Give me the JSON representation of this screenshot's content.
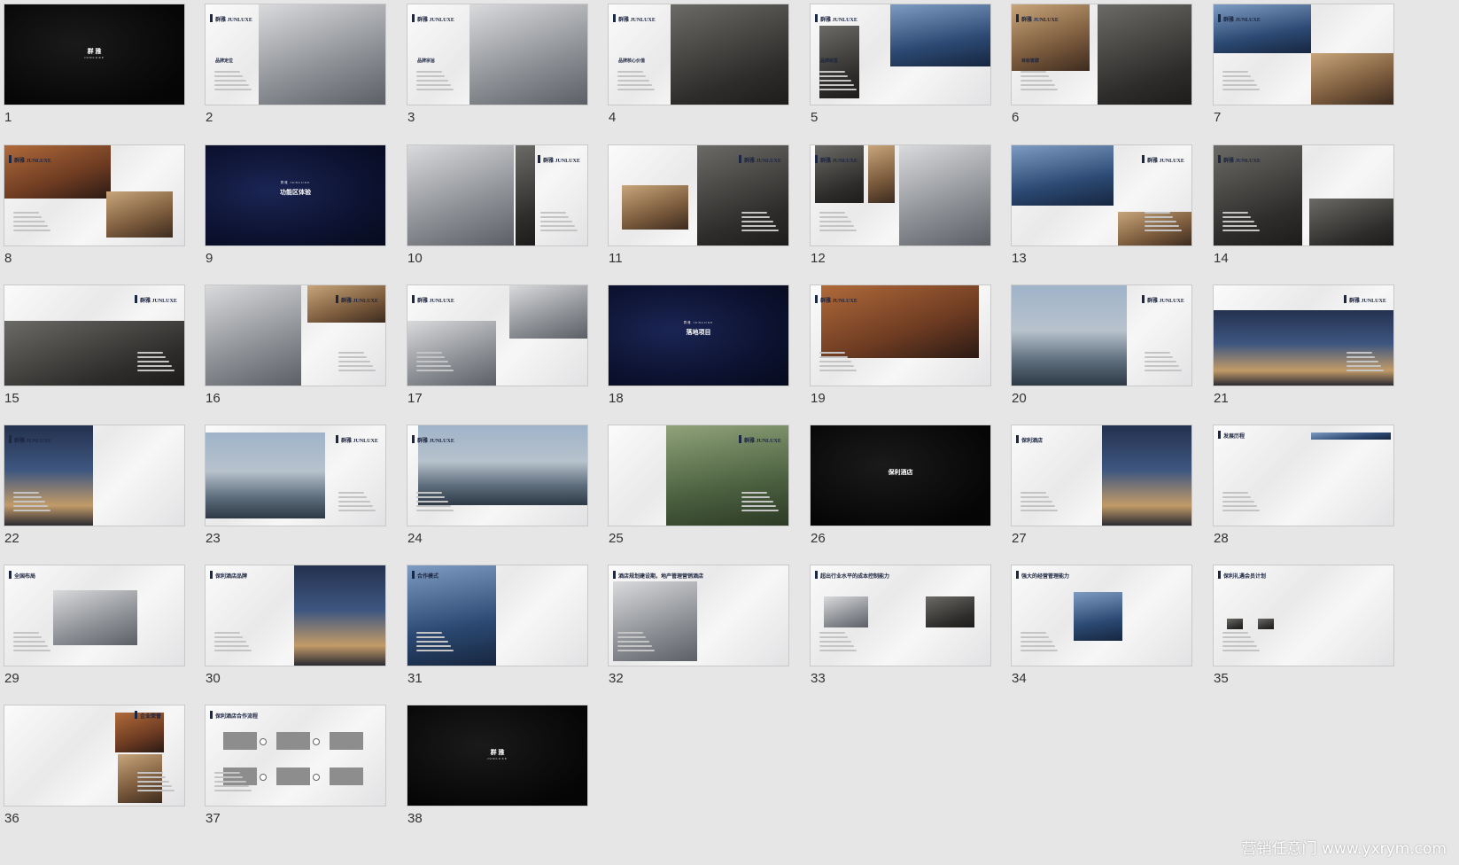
{
  "slides": [
    {
      "number": "1",
      "style": "black",
      "title": "群 雅",
      "subtitle": "JUNLUXE"
    },
    {
      "number": "2",
      "style": "white",
      "title": "群雅 JUNLUXE",
      "heading": "品牌定位"
    },
    {
      "number": "3",
      "style": "white",
      "title": "群雅 JUNLUXE",
      "heading": "品牌宗旨"
    },
    {
      "number": "4",
      "style": "white",
      "title": "群雅 JUNLUXE",
      "heading": "品牌核心价值"
    },
    {
      "number": "5",
      "style": "white",
      "title": "群雅 JUNLUXE",
      "heading": "品牌标签"
    },
    {
      "number": "6",
      "style": "white",
      "title": "群雅 JUNLUXE",
      "heading": "目标客群"
    },
    {
      "number": "7",
      "style": "white",
      "title": "群雅 JUNLUXE"
    },
    {
      "number": "8",
      "style": "white",
      "title": "群雅 JUNLUXE"
    },
    {
      "number": "9",
      "style": "navy",
      "title": "功能区体验",
      "subtitle": "群雅 JUNLUXE"
    },
    {
      "number": "10",
      "style": "white",
      "title": "群雅 JUNLUXE"
    },
    {
      "number": "11",
      "style": "white",
      "title": "群雅 JUNLUXE"
    },
    {
      "number": "12",
      "style": "white",
      "title": "群雅 JUNLUXE"
    },
    {
      "number": "13",
      "style": "white",
      "title": "群雅 JUNLUXE"
    },
    {
      "number": "14",
      "style": "white",
      "title": "群雅 JUNLUXE"
    },
    {
      "number": "15",
      "style": "white",
      "title": "群雅 JUNLUXE"
    },
    {
      "number": "16",
      "style": "white",
      "title": "群雅 JUNLUXE"
    },
    {
      "number": "17",
      "style": "white",
      "title": "群雅 JUNLUXE"
    },
    {
      "number": "18",
      "style": "navy",
      "title": "落地项目",
      "subtitle": "群雅 JUNLUXE"
    },
    {
      "number": "19",
      "style": "white",
      "title": "群雅 JUNLUXE"
    },
    {
      "number": "20",
      "style": "white",
      "title": "群雅 JUNLUXE"
    },
    {
      "number": "21",
      "style": "white",
      "title": "群雅 JUNLUXE"
    },
    {
      "number": "22",
      "style": "white",
      "title": "群雅 JUNLUXE"
    },
    {
      "number": "23",
      "style": "white",
      "title": "群雅 JUNLUXE"
    },
    {
      "number": "24",
      "style": "white",
      "title": "群雅 JUNLUXE"
    },
    {
      "number": "25",
      "style": "white",
      "title": "群雅 JUNLUXE"
    },
    {
      "number": "26",
      "style": "black",
      "title": "保利酒店"
    },
    {
      "number": "27",
      "style": "white",
      "title": "保利酒店"
    },
    {
      "number": "28",
      "style": "white",
      "title": "发展历程"
    },
    {
      "number": "29",
      "style": "white",
      "title": "全国布局"
    },
    {
      "number": "30",
      "style": "white",
      "title": "保利酒店品牌"
    },
    {
      "number": "31",
      "style": "white",
      "title": "合作模式"
    },
    {
      "number": "32",
      "style": "white",
      "title": "酒店规划建设期，地产管理营销酒店"
    },
    {
      "number": "33",
      "style": "white",
      "title": "超出行业水平的成本控制能力"
    },
    {
      "number": "34",
      "style": "white",
      "title": "强大的经营管理能力"
    },
    {
      "number": "35",
      "style": "white",
      "title": "保利礼遇会员计划"
    },
    {
      "number": "36",
      "style": "white",
      "title": "企业荣誉"
    },
    {
      "number": "37",
      "style": "white",
      "title": "保利酒店合作流程"
    },
    {
      "number": "38",
      "style": "black",
      "title": "群 雅",
      "subtitle": "JUNLUXE"
    }
  ],
  "watermark": "营销任意门 www.yxrym.com",
  "colors": {
    "background": "#e6e6e6",
    "navy": "#1c2743",
    "slide_number": "#333333"
  }
}
